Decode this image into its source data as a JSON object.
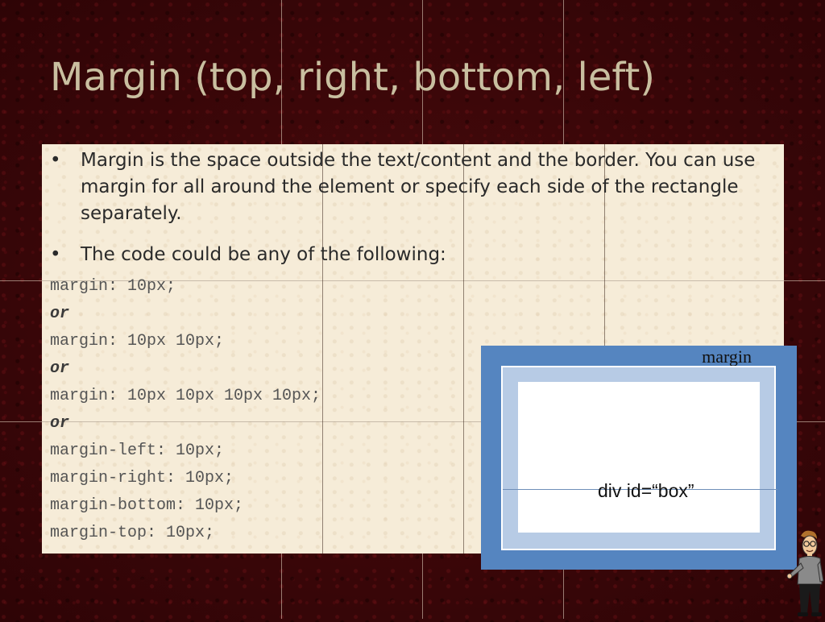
{
  "slide": {
    "title": "Margin (top, right, bottom, left)"
  },
  "bullets": [
    {
      "text": "Margin is the space outside the text/content and the border. You can use margin for all around the element or specify each side of the rectangle separately."
    },
    {
      "text": "The code could be any of the following:"
    }
  ],
  "bullet_glyph": "•",
  "code_lines": [
    "margin: 10px;",
    "or",
    "margin: 10px 10px;",
    "or",
    "margin: 10px 10px 10px 10px;",
    "or",
    "margin-left: 10px;",
    "margin-right: 10px;",
    "margin-bottom: 10px;",
    "margin-top: 10px;"
  ],
  "diagram": {
    "margin_label": "margin",
    "box_label": "div id=“box”"
  },
  "colors": {
    "background": "#3a0608",
    "title": "#c9bfa0",
    "panel": "#f6ecd8",
    "margin_area": "#5585c0",
    "border_area": "#b7cbe5",
    "content_area": "#ffffff"
  },
  "icons": {
    "character": "cartoon-presenter-icon"
  }
}
